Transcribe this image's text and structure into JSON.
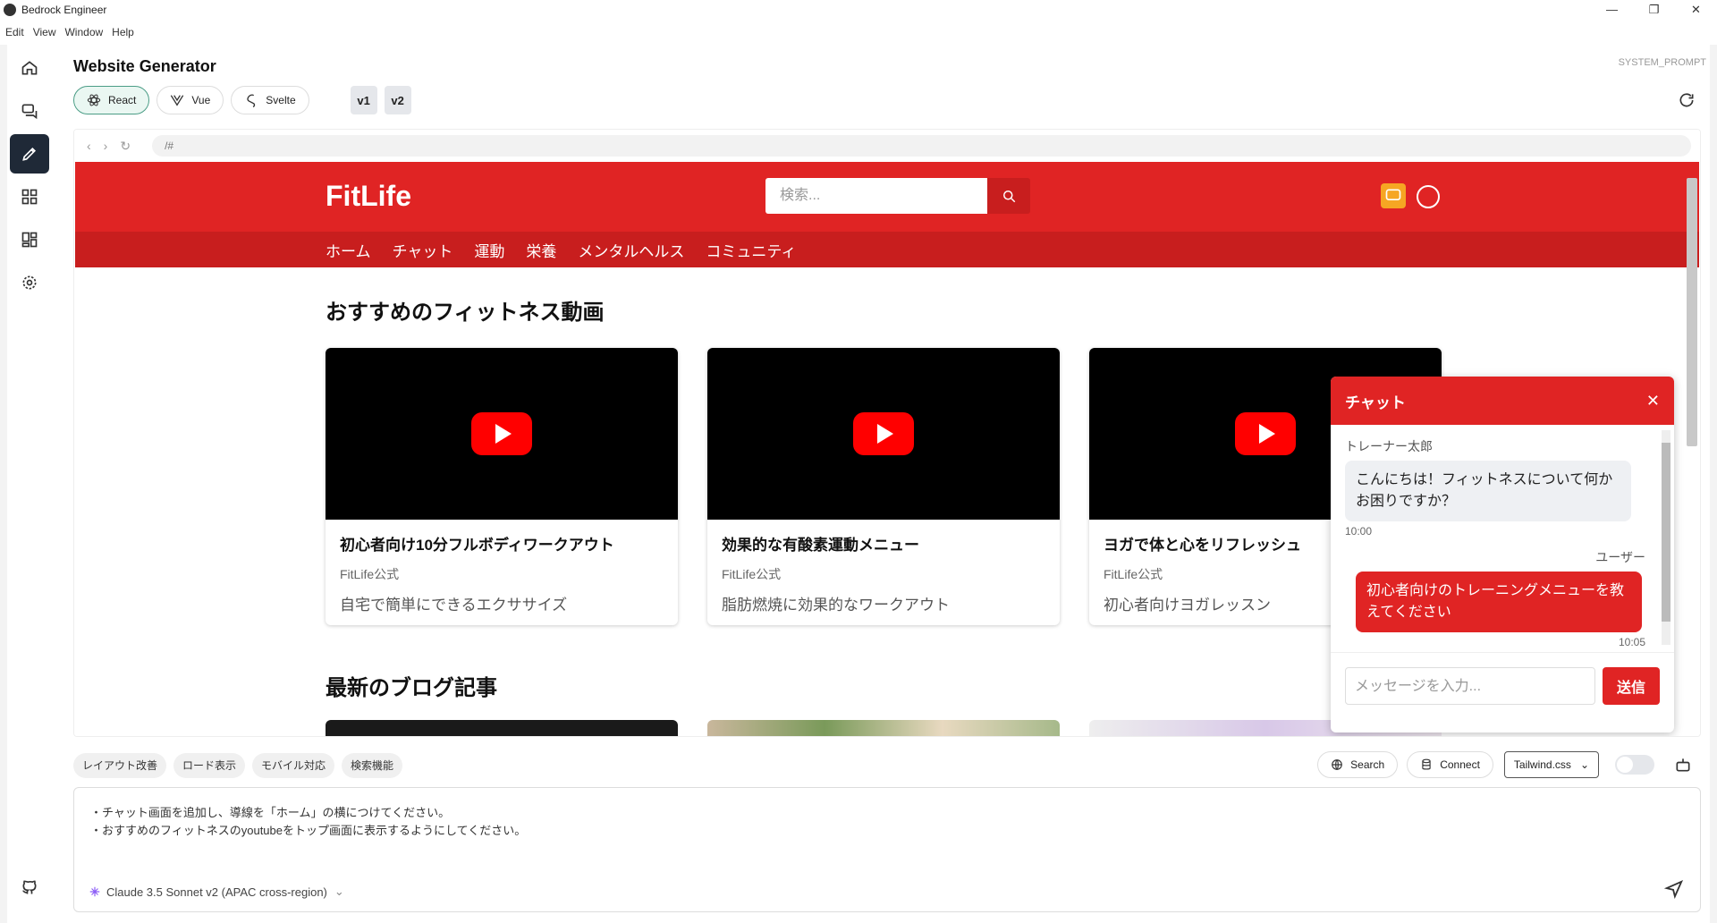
{
  "window": {
    "title": "Bedrock Engineer",
    "controls": [
      "—",
      "❐",
      "✕"
    ]
  },
  "menu": [
    "Edit",
    "View",
    "Window",
    "Help"
  ],
  "sidebar": {
    "items": [
      "home-icon",
      "chat-icon",
      "pen-icon",
      "grid-icon",
      "layout-icon",
      "settings-icon"
    ],
    "bottom": "github-icon"
  },
  "header": {
    "title": "Website Generator",
    "system_prompt": "SYSTEM_PROMPT"
  },
  "frameworks": [
    {
      "label": "React",
      "active": true
    },
    {
      "label": "Vue",
      "active": false
    },
    {
      "label": "Svelte",
      "active": false
    }
  ],
  "versions": [
    "v1",
    "v2"
  ],
  "browser": {
    "url": "/#"
  },
  "site": {
    "logo": "FitLife",
    "search_placeholder": "検索...",
    "nav": [
      "ホーム",
      "チャット",
      "運動",
      "栄養",
      "メンタルヘルス",
      "コミュニティ"
    ],
    "section1_title": "おすすめのフィットネス動画",
    "videos": [
      {
        "title": "初心者向け10分フルボディワークアウト",
        "channel": "FitLife公式",
        "desc": "自宅で簡単にできるエクササイズ"
      },
      {
        "title": "効果的な有酸素運動メニュー",
        "channel": "FitLife公式",
        "desc": "脂肪燃焼に効果的なワークアウト"
      },
      {
        "title": "ヨガで体と心をリフレッシュ",
        "channel": "FitLife公式",
        "desc": "初心者向けヨガレッスン"
      }
    ],
    "section2_title": "最新のブログ記事"
  },
  "chat": {
    "title": "チャット",
    "messages": [
      {
        "sender": "トレーナー太郎",
        "text": "こんにちは！フィットネスについて何かお困りですか？",
        "time": "10:00"
      },
      {
        "sender": "ユーザー",
        "text": "初心者向けのトレーニングメニューを教えてください",
        "time": "10:05"
      }
    ],
    "input_placeholder": "メッセージを入力...",
    "send_label": "送信"
  },
  "chips": [
    "レイアウト改善",
    "ロード表示",
    "モバイル対応",
    "検索機能"
  ],
  "tools": {
    "search": "Search",
    "connect": "Connect",
    "style": "Tailwind.css"
  },
  "prompt": {
    "lines": [
      "・チャット画面を追加し、導線を「ホーム」の横につけてください。",
      "・おすすめのフィットネスのyoutubeをトップ画面に表示するようにしてください。"
    ],
    "model": "Claude 3.5 Sonnet v2 (APAC cross-region)"
  },
  "colors": {
    "brand_red": "#e02424",
    "dark_red": "#c81e1e",
    "active_sidebar": "#1f2937",
    "react_active": "#4b9d86"
  }
}
